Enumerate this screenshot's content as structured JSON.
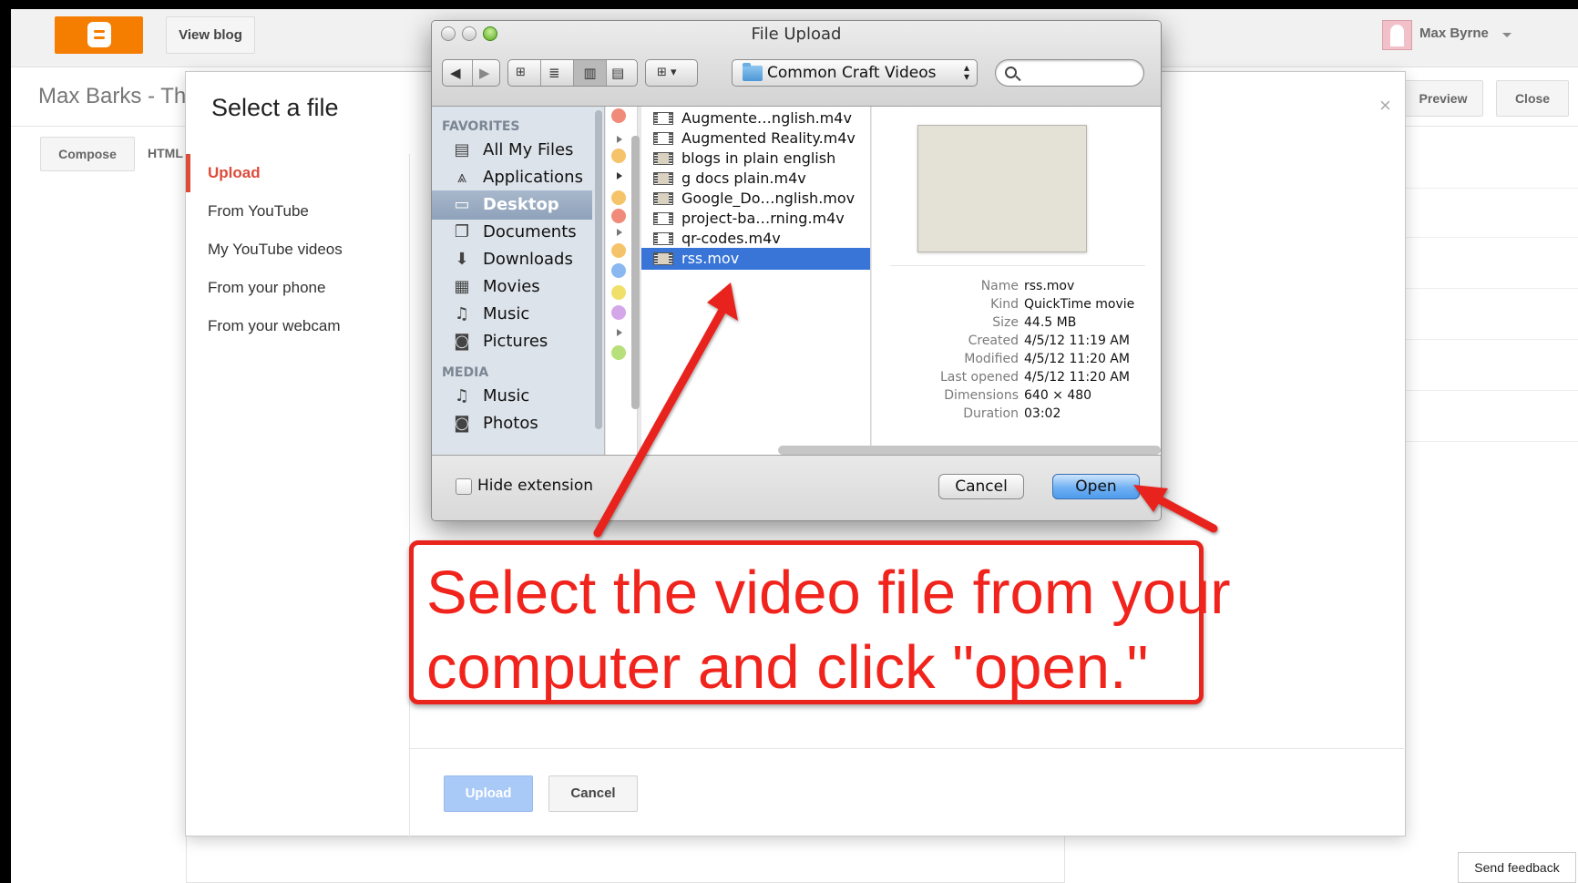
{
  "topbar": {
    "view_blog": "View blog",
    "user_name": "Max Byrne"
  },
  "editor": {
    "blog_title": "Max Barks - Th",
    "compose_tab": "Compose",
    "html_tab": "HTML",
    "preview_button": "Preview",
    "close_button": "Close",
    "send_feedback": "Send feedback"
  },
  "select_dialog": {
    "title": "Select a file",
    "close": "×",
    "nav": [
      {
        "label": "Upload",
        "active": true
      },
      {
        "label": "From YouTube"
      },
      {
        "label": "My YouTube videos"
      },
      {
        "label": "From your phone"
      },
      {
        "label": "From your webcam"
      }
    ],
    "upload_button": "Upload",
    "cancel_button": "Cancel"
  },
  "file_upload": {
    "window_title": "File Upload",
    "current_folder": "Common Craft Videos",
    "search_placeholder": "",
    "sidebar": {
      "favorites_header": "FAVORITES",
      "favorites": [
        {
          "label": "All My Files",
          "icon": "all-files-icon"
        },
        {
          "label": "Applications",
          "icon": "applications-icon"
        },
        {
          "label": "Desktop",
          "icon": "desktop-icon",
          "selected": true
        },
        {
          "label": "Documents",
          "icon": "documents-icon"
        },
        {
          "label": "Downloads",
          "icon": "downloads-icon"
        },
        {
          "label": "Movies",
          "icon": "movies-icon"
        },
        {
          "label": "Music",
          "icon": "music-icon"
        },
        {
          "label": "Pictures",
          "icon": "pictures-icon"
        }
      ],
      "media_header": "MEDIA",
      "media": [
        {
          "label": "Music",
          "icon": "music-icon"
        },
        {
          "label": "Photos",
          "icon": "photos-icon"
        }
      ]
    },
    "files": [
      {
        "name": "Augmente…nglish.m4v"
      },
      {
        "name": "Augmented Reality.m4v"
      },
      {
        "name": "blogs in plain english"
      },
      {
        "name": "g docs plain.m4v"
      },
      {
        "name": "Google_Do…nglish.mov"
      },
      {
        "name": "project-ba…rning.m4v"
      },
      {
        "name": "qr-codes.m4v"
      },
      {
        "name": "rss.mov",
        "selected": true
      }
    ],
    "info": [
      {
        "key": "Name",
        "value": "rss.mov"
      },
      {
        "key": "Kind",
        "value": "QuickTime movie"
      },
      {
        "key": "Size",
        "value": "44.5 MB"
      },
      {
        "key": "Created",
        "value": "4/5/12 11:19 AM"
      },
      {
        "key": "Modified",
        "value": "4/5/12 11:20 AM"
      },
      {
        "key": "Last opened",
        "value": "4/5/12 11:20 AM"
      },
      {
        "key": "Dimensions",
        "value": "640 × 480"
      },
      {
        "key": "Duration",
        "value": "03:02"
      }
    ],
    "hide_extension": "Hide extension",
    "cancel_button": "Cancel",
    "open_button": "Open"
  },
  "annotation": {
    "line1": "Select the video file from your",
    "line2": "computer and click \"open.\"",
    "color": "#f0241c"
  }
}
